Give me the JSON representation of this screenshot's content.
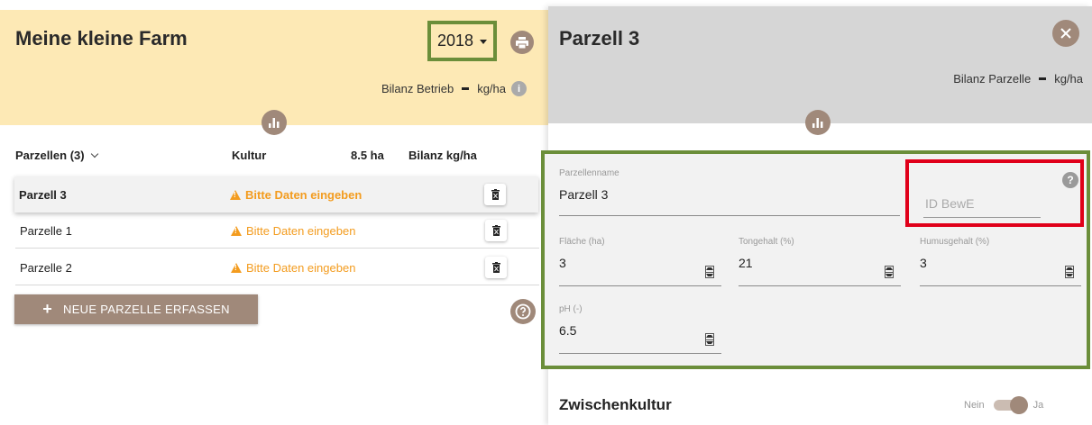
{
  "farm": {
    "title": "Meine kleine Farm",
    "year": "2018",
    "bilanz_label": "Bilanz Betrieb",
    "bilanz_unit": "kg/ha"
  },
  "parcels_table": {
    "header_parcels": "Parzellen (3)",
    "header_kultur": "Kultur",
    "header_area": "8.5 ha",
    "header_bilanz": "Bilanz kg/ha",
    "rows": [
      {
        "name": "Parzell 3",
        "status": "Bitte Daten eingeben",
        "active": true
      },
      {
        "name": "Parzelle 1",
        "status": "Bitte Daten eingeben",
        "active": false
      },
      {
        "name": "Parzelle 2",
        "status": "Bitte Daten eingeben",
        "active": false
      }
    ]
  },
  "new_parcel_button": "NEUE PARZELLE ERFASSEN",
  "detail": {
    "title": "Parzell 3",
    "bilanz_label": "Bilanz Parzelle",
    "bilanz_unit": "kg/ha",
    "fields": {
      "parzellenname": {
        "label": "Parzellenname",
        "value": "Parzell 3"
      },
      "id_bewe": {
        "placeholder": "ID BewE"
      },
      "flaeche": {
        "label": "Fläche (ha)",
        "value": "3"
      },
      "tongehalt": {
        "label": "Tongehalt (%)",
        "value": "21"
      },
      "humusgehalt": {
        "label": "Humusgehalt (%)",
        "value": "3"
      },
      "ph": {
        "label": "pH (-)",
        "value": "6.5"
      }
    },
    "zwischenkultur": {
      "title": "Zwischenkultur",
      "off_label": "Nein",
      "on_label": "Ja",
      "enabled": true
    }
  },
  "colors": {
    "farm_header_bg": "#fde9b5",
    "detail_header_bg": "#d6d6d6",
    "accent_brown": "#a0897a",
    "warning_orange": "#f39c1f",
    "highlight_green": "#6b8e3a",
    "highlight_red": "#e0001a"
  },
  "icons": [
    "print-icon",
    "info-icon",
    "bar-chart-icon",
    "chevron-down-icon",
    "warning-icon",
    "trash-icon",
    "plus-icon",
    "help-icon",
    "close-icon"
  ]
}
